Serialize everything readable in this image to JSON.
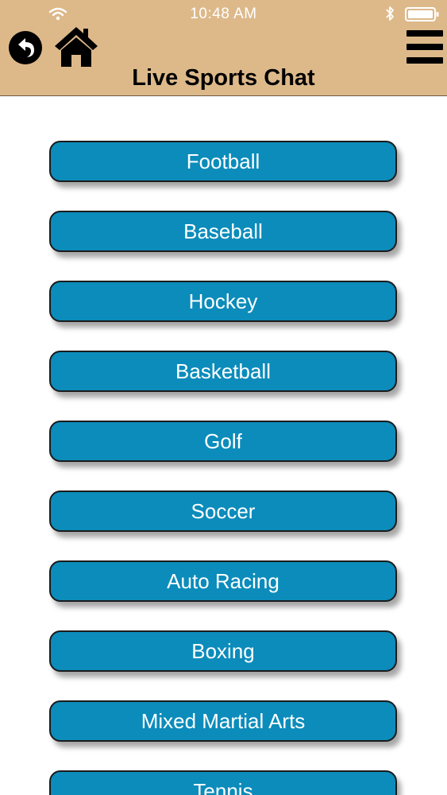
{
  "status_bar": {
    "time": "10:48 AM",
    "icons": [
      "wifi-icon",
      "bluetooth-icon",
      "battery-icon"
    ]
  },
  "header": {
    "title": "Live Sports Chat",
    "background_color": "#ddb98a",
    "icons": [
      "back-icon",
      "home-icon",
      "menu-icon"
    ]
  },
  "sports": [
    {
      "label": "Football"
    },
    {
      "label": "Baseball"
    },
    {
      "label": "Hockey"
    },
    {
      "label": "Basketball"
    },
    {
      "label": "Golf"
    },
    {
      "label": "Soccer"
    },
    {
      "label": "Auto Racing"
    },
    {
      "label": "Boxing"
    },
    {
      "label": "Mixed Martial Arts"
    },
    {
      "label": "Tennis"
    }
  ],
  "colors": {
    "button_fill": "#0b8cbb",
    "button_border": "#1b1b1b",
    "button_text": "#ffffff"
  }
}
